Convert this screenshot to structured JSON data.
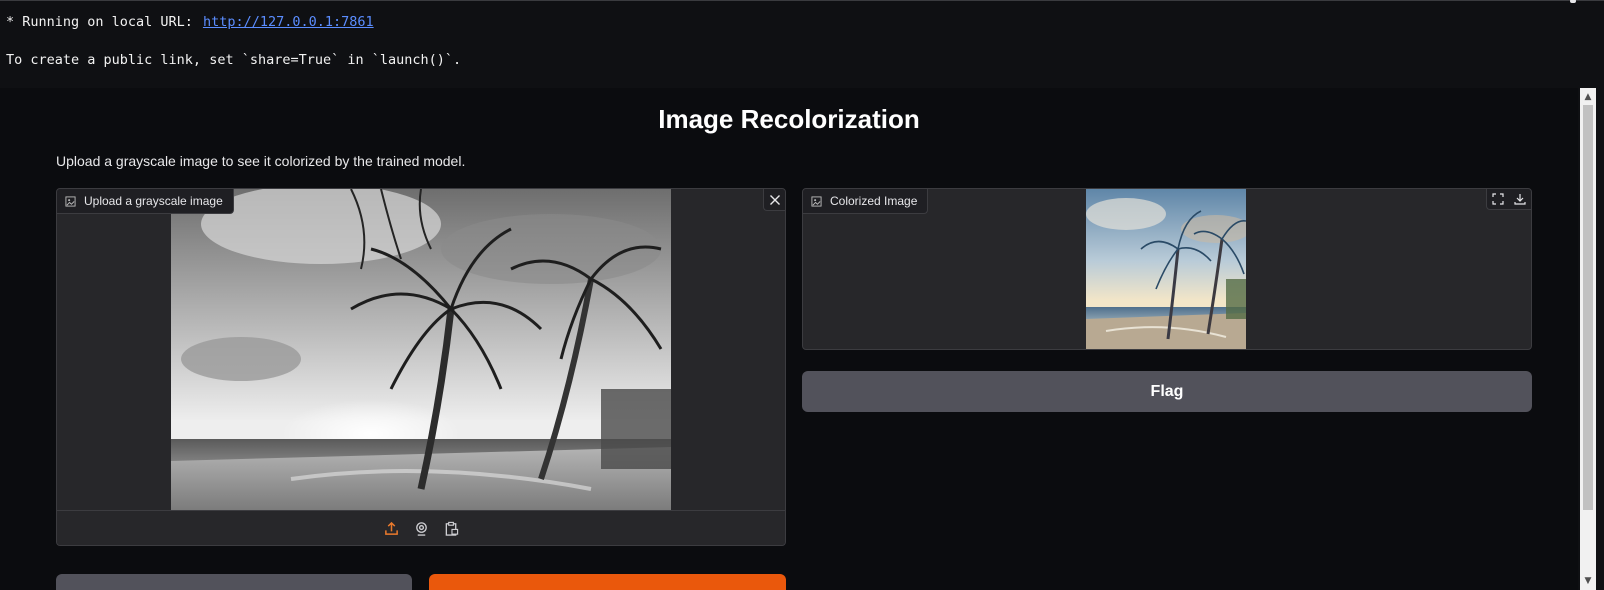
{
  "console": {
    "prefix": "* Running on local URL:",
    "url": "http://127.0.0.1:7861",
    "share_hint": "To create a public link, set `share=True` in `launch()`."
  },
  "app": {
    "title": "Image Recolorization",
    "description": "Upload a grayscale image to see it colorized by the trained model."
  },
  "input_panel": {
    "label": "Upload a grayscale image",
    "label_icon": "image-icon",
    "close_icon": "close-icon",
    "sources": [
      "upload-icon",
      "webcam-icon",
      "clipboard-icon"
    ],
    "accent": "#ea7a2c"
  },
  "output_panel": {
    "label": "Colorized Image",
    "label_icon": "image-icon",
    "tools": [
      "fullscreen-icon",
      "download-icon"
    ]
  },
  "buttons": {
    "flag": "Flag",
    "clear_color": "#52525b",
    "submit_color": "#ea580c"
  }
}
